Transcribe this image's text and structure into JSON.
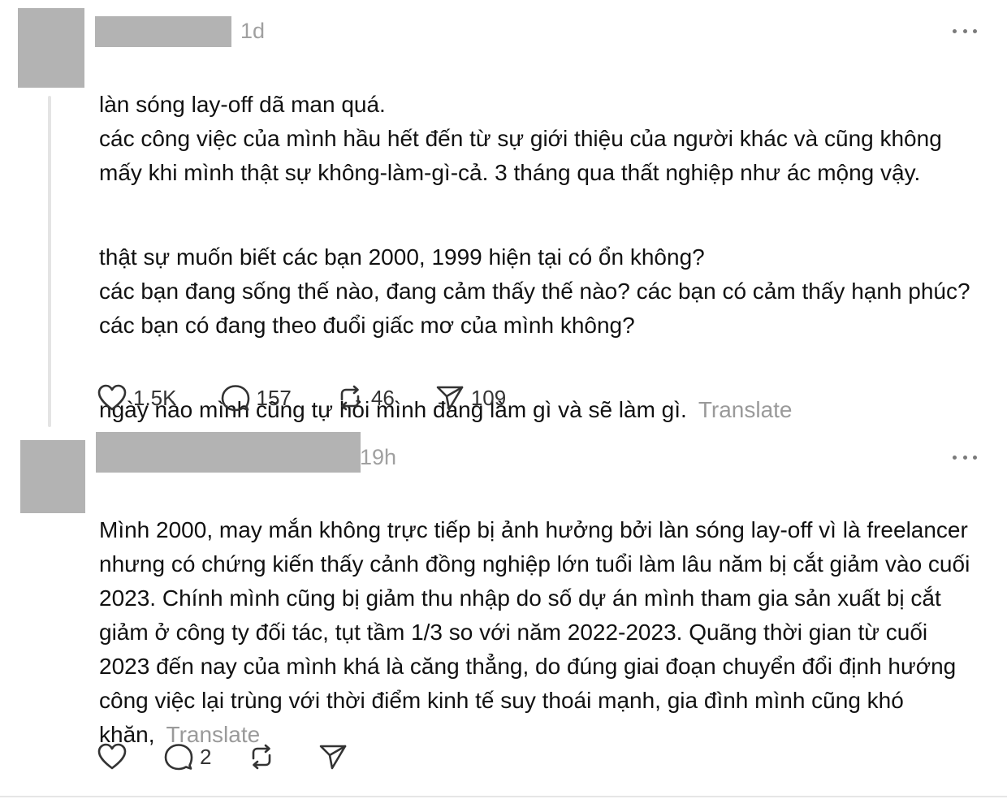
{
  "posts": [
    {
      "time": "1d",
      "paragraphs": [
        "làn sóng lay-off dã man quá.\ncác công việc của mình hầu hết đến từ sự giới thiệu của người khác và cũng không mấy khi mình thật sự không-làm-gì-cả. 3 tháng qua thất nghiệp như ác mộng vậy.",
        "thật sự muốn biết các bạn 2000, 1999 hiện tại có ổn không?\ncác bạn đang sống thế nào, đang cảm thấy thế nào? các bạn có cảm thấy hạnh phúc? các bạn có đang theo đuổi giấc mơ của mình không?",
        "ngày nào mình cũng tự hỏi mình đang làm gì và sẽ làm gì."
      ],
      "translate_label": "Translate",
      "stats": {
        "likes": "1.5K",
        "replies": "157",
        "reposts": "46",
        "shares": "109"
      }
    },
    {
      "time": "19h",
      "paragraphs": [
        "Mình 2000, may mắn không trực tiếp bị ảnh hưởng bởi làn sóng lay-off vì là freelancer nhưng có chứng kiến thấy cảnh đồng nghiệp lớn tuổi làm lâu năm bị cắt giảm vào cuối 2023. Chính mình cũng bị giảm thu nhập do số dự án mình tham gia sản xuất bị cắt giảm ở công ty đối tác, tụt tầm 1/3 so với năm 2022-2023. Quãng thời gian từ cuối 2023 đến nay của mình khá là căng thẳng, do đúng giai đoạn chuyển đổi định hướng công việc lại trùng với thời điểm kinh tế suy thoái mạnh, gia đình mình cũng khó khăn,"
      ],
      "translate_label": "Translate",
      "stats": {
        "likes": "",
        "replies": "2",
        "reposts": "",
        "shares": ""
      }
    }
  ]
}
